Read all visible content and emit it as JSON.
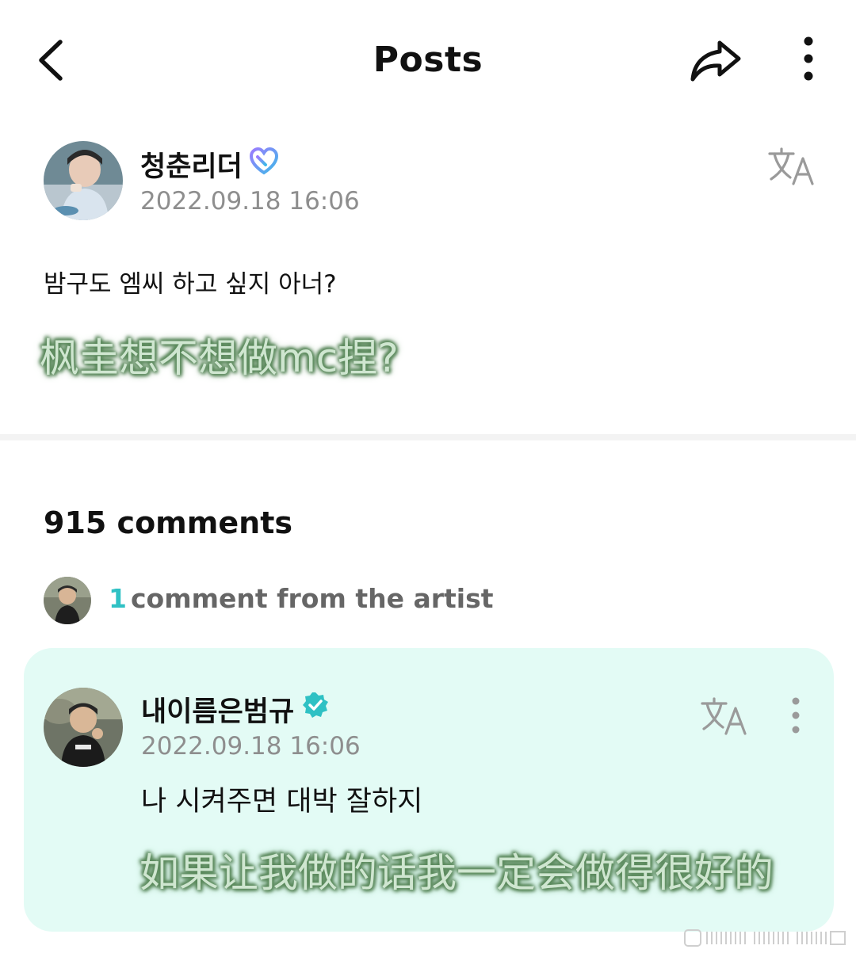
{
  "header": {
    "title": "Posts",
    "back_icon": "chevron-left-icon",
    "share_icon": "share-arrow-icon",
    "more_icon": "more-vertical-icon"
  },
  "post": {
    "author": "청춘리더",
    "timestamp": "2022.09.18 16:06",
    "body": "밤구도 엠씨 하고 싶지 아너?",
    "overlay_caption": "枫圭想不想做mc捏?",
    "verified_icon": "heart-badge-icon",
    "translate_icon": "translate-icon"
  },
  "comments": {
    "count_label": "915 comments",
    "artist_count": "1",
    "artist_label": "comment from the artist",
    "items": [
      {
        "author": "내이름은범규",
        "timestamp": "2022.09.18 16:06",
        "body": "나 시켜주면 대박 잘하지",
        "overlay_caption": "如果让我做的话我一定会做得很好的",
        "verified_icon": "verified-check-icon"
      }
    ]
  },
  "colors": {
    "accent_teal": "#2fc1c4",
    "card_bg": "#e3fbf5",
    "caption_glow": "#5b8a5c"
  }
}
